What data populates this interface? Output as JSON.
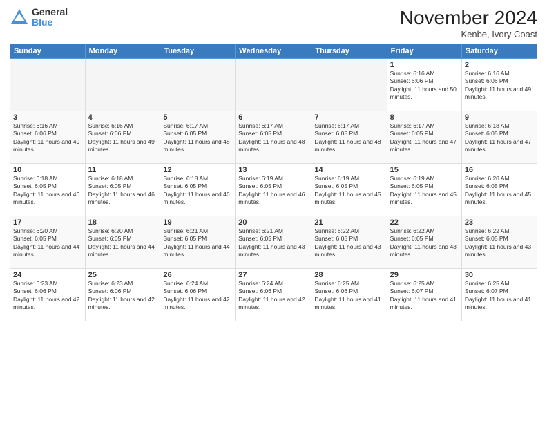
{
  "logo": {
    "general": "General",
    "blue": "Blue"
  },
  "header": {
    "month": "November 2024",
    "location": "Kenbe, Ivory Coast"
  },
  "days_of_week": [
    "Sunday",
    "Monday",
    "Tuesday",
    "Wednesday",
    "Thursday",
    "Friday",
    "Saturday"
  ],
  "weeks": [
    [
      {
        "day": "",
        "empty": true
      },
      {
        "day": "",
        "empty": true
      },
      {
        "day": "",
        "empty": true
      },
      {
        "day": "",
        "empty": true
      },
      {
        "day": "",
        "empty": true
      },
      {
        "day": "1",
        "sunrise": "6:16 AM",
        "sunset": "6:06 PM",
        "daylight": "11 hours and 50 minutes."
      },
      {
        "day": "2",
        "sunrise": "6:16 AM",
        "sunset": "6:06 PM",
        "daylight": "11 hours and 49 minutes."
      }
    ],
    [
      {
        "day": "3",
        "sunrise": "6:16 AM",
        "sunset": "6:06 PM",
        "daylight": "11 hours and 49 minutes."
      },
      {
        "day": "4",
        "sunrise": "6:16 AM",
        "sunset": "6:06 PM",
        "daylight": "11 hours and 49 minutes."
      },
      {
        "day": "5",
        "sunrise": "6:17 AM",
        "sunset": "6:05 PM",
        "daylight": "11 hours and 48 minutes."
      },
      {
        "day": "6",
        "sunrise": "6:17 AM",
        "sunset": "6:05 PM",
        "daylight": "11 hours and 48 minutes."
      },
      {
        "day": "7",
        "sunrise": "6:17 AM",
        "sunset": "6:05 PM",
        "daylight": "11 hours and 48 minutes."
      },
      {
        "day": "8",
        "sunrise": "6:17 AM",
        "sunset": "6:05 PM",
        "daylight": "11 hours and 47 minutes."
      },
      {
        "day": "9",
        "sunrise": "6:18 AM",
        "sunset": "6:05 PM",
        "daylight": "11 hours and 47 minutes."
      }
    ],
    [
      {
        "day": "10",
        "sunrise": "6:18 AM",
        "sunset": "6:05 PM",
        "daylight": "11 hours and 46 minutes."
      },
      {
        "day": "11",
        "sunrise": "6:18 AM",
        "sunset": "6:05 PM",
        "daylight": "11 hours and 46 minutes."
      },
      {
        "day": "12",
        "sunrise": "6:18 AM",
        "sunset": "6:05 PM",
        "daylight": "11 hours and 46 minutes."
      },
      {
        "day": "13",
        "sunrise": "6:19 AM",
        "sunset": "6:05 PM",
        "daylight": "11 hours and 46 minutes."
      },
      {
        "day": "14",
        "sunrise": "6:19 AM",
        "sunset": "6:05 PM",
        "daylight": "11 hours and 45 minutes."
      },
      {
        "day": "15",
        "sunrise": "6:19 AM",
        "sunset": "6:05 PM",
        "daylight": "11 hours and 45 minutes."
      },
      {
        "day": "16",
        "sunrise": "6:20 AM",
        "sunset": "6:05 PM",
        "daylight": "11 hours and 45 minutes."
      }
    ],
    [
      {
        "day": "17",
        "sunrise": "6:20 AM",
        "sunset": "6:05 PM",
        "daylight": "11 hours and 44 minutes."
      },
      {
        "day": "18",
        "sunrise": "6:20 AM",
        "sunset": "6:05 PM",
        "daylight": "11 hours and 44 minutes."
      },
      {
        "day": "19",
        "sunrise": "6:21 AM",
        "sunset": "6:05 PM",
        "daylight": "11 hours and 44 minutes."
      },
      {
        "day": "20",
        "sunrise": "6:21 AM",
        "sunset": "6:05 PM",
        "daylight": "11 hours and 43 minutes."
      },
      {
        "day": "21",
        "sunrise": "6:22 AM",
        "sunset": "6:05 PM",
        "daylight": "11 hours and 43 minutes."
      },
      {
        "day": "22",
        "sunrise": "6:22 AM",
        "sunset": "6:05 PM",
        "daylight": "11 hours and 43 minutes."
      },
      {
        "day": "23",
        "sunrise": "6:22 AM",
        "sunset": "6:05 PM",
        "daylight": "11 hours and 43 minutes."
      }
    ],
    [
      {
        "day": "24",
        "sunrise": "6:23 AM",
        "sunset": "6:06 PM",
        "daylight": "11 hours and 42 minutes."
      },
      {
        "day": "25",
        "sunrise": "6:23 AM",
        "sunset": "6:06 PM",
        "daylight": "11 hours and 42 minutes."
      },
      {
        "day": "26",
        "sunrise": "6:24 AM",
        "sunset": "6:06 PM",
        "daylight": "11 hours and 42 minutes."
      },
      {
        "day": "27",
        "sunrise": "6:24 AM",
        "sunset": "6:06 PM",
        "daylight": "11 hours and 42 minutes."
      },
      {
        "day": "28",
        "sunrise": "6:25 AM",
        "sunset": "6:06 PM",
        "daylight": "11 hours and 41 minutes."
      },
      {
        "day": "29",
        "sunrise": "6:25 AM",
        "sunset": "6:07 PM",
        "daylight": "11 hours and 41 minutes."
      },
      {
        "day": "30",
        "sunrise": "6:25 AM",
        "sunset": "6:07 PM",
        "daylight": "11 hours and 41 minutes."
      }
    ]
  ]
}
